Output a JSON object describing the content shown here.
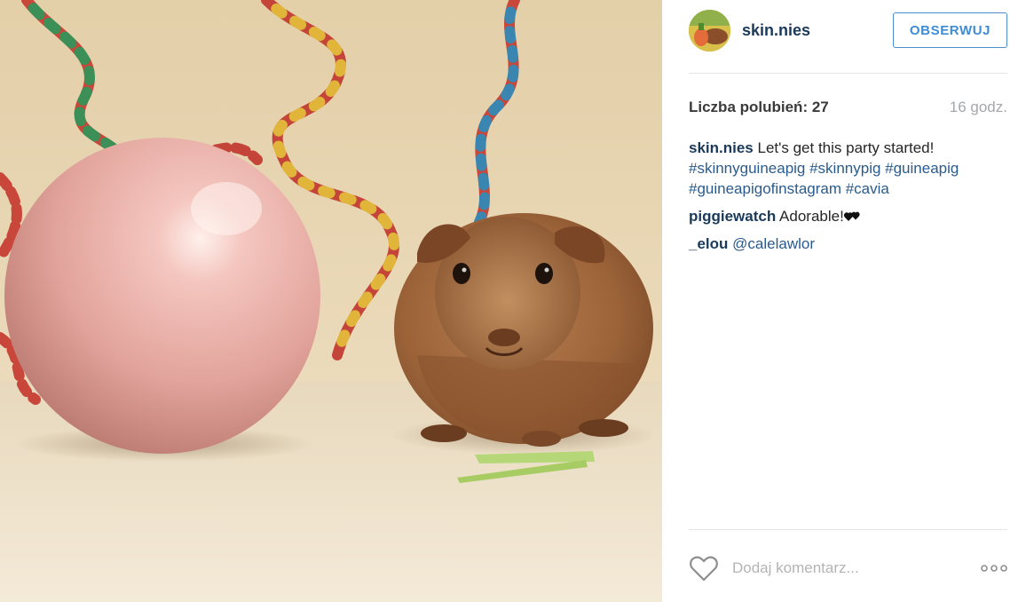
{
  "post": {
    "username": "skin.nies",
    "follow_label": "OBSERWUJ",
    "likes_text": "Liczba polubień: 27",
    "time_ago": "16 godz."
  },
  "comments": [
    {
      "user": "skin.nies",
      "text": "Let's get this party started!",
      "hashtags": "#skinnyguineapig #skinnypig #guineapig #guineapigofinstagram #cavia"
    },
    {
      "user": "piggiewatch",
      "text": "Adorable!"
    },
    {
      "user": "_elou",
      "mention": "@calelawlor"
    }
  ],
  "footer": {
    "comment_placeholder": "Dodaj komentarz..."
  },
  "icons": {
    "like": "heart-outline-icon",
    "more": "more-options-icon",
    "emoji": "black-hearts-icon"
  },
  "colors": {
    "username": "#1b3a5a",
    "follow_accent": "#3f8cd3",
    "hashtag": "#2a5b8c",
    "muted": "#a5a7aa"
  }
}
